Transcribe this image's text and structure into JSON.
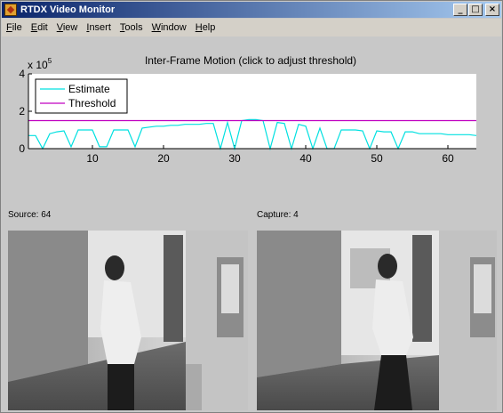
{
  "window": {
    "title": "RTDX Video Monitor",
    "minimize": "_",
    "maximize": "□",
    "close": "×"
  },
  "menu": [
    {
      "label": "File",
      "u": "F",
      "rest": "ile"
    },
    {
      "label": "Edit",
      "u": "E",
      "rest": "dit"
    },
    {
      "label": "View",
      "u": "V",
      "rest": "iew"
    },
    {
      "label": "Insert",
      "u": "I",
      "rest": "nsert"
    },
    {
      "label": "Tools",
      "u": "T",
      "rest": "ools"
    },
    {
      "label": "Window",
      "u": "W",
      "rest": "indow"
    },
    {
      "label": "Help",
      "u": "H",
      "rest": "elp"
    }
  ],
  "chart_data": {
    "type": "line",
    "title": "Inter-Frame Motion (click to adjust threshold)",
    "y_multiplier_base": "x 10",
    "y_multiplier_exp": "5",
    "xlim": [
      1,
      64
    ],
    "ylim": [
      0,
      4
    ],
    "xticks": [
      10,
      20,
      30,
      40,
      50,
      60
    ],
    "yticks": [
      0,
      2,
      4
    ],
    "legend_position": "top-left",
    "series": [
      {
        "name": "Estimate",
        "color": "#00e0e0",
        "x": [
          1,
          2,
          3,
          4,
          5,
          6,
          7,
          8,
          9,
          10,
          11,
          12,
          13,
          14,
          15,
          16,
          17,
          18,
          19,
          20,
          21,
          22,
          23,
          24,
          25,
          26,
          27,
          28,
          29,
          30,
          31,
          32,
          33,
          34,
          35,
          36,
          37,
          38,
          39,
          40,
          41,
          42,
          43,
          44,
          45,
          46,
          47,
          48,
          49,
          50,
          51,
          52,
          53,
          54,
          55,
          56,
          57,
          58,
          59,
          60,
          61,
          62,
          63,
          64
        ],
        "values": [
          0.7,
          0.7,
          0,
          0.8,
          0.9,
          0.95,
          0.1,
          1.0,
          1.0,
          1.0,
          0.1,
          0.1,
          1.0,
          1.0,
          1.0,
          0.1,
          1.1,
          1.15,
          1.2,
          1.2,
          1.25,
          1.25,
          1.3,
          1.3,
          1.3,
          1.35,
          1.35,
          0,
          1.4,
          0,
          1.5,
          1.55,
          1.55,
          1.5,
          0,
          1.4,
          1.35,
          0,
          1.3,
          1.2,
          0,
          1.1,
          0,
          0,
          1.0,
          1.0,
          1.0,
          0.95,
          0,
          0.95,
          0.9,
          0.9,
          0,
          0.9,
          0.9,
          0.8,
          0.8,
          0.8,
          0.8,
          0.75,
          0.75,
          0.75,
          0.75,
          0.7
        ]
      },
      {
        "name": "Threshold",
        "color": "#c000c0",
        "x": [
          1,
          64
        ],
        "values": [
          1.5,
          1.5
        ]
      }
    ]
  },
  "panels": {
    "source_label": "Source: 64",
    "capture_label": "Capture: 4"
  }
}
